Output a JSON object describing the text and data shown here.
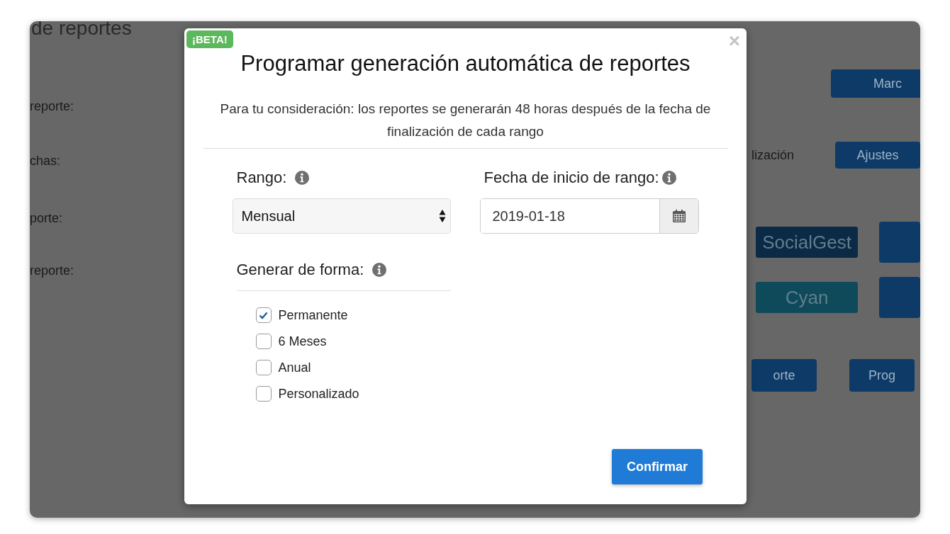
{
  "background": {
    "heading": "de reportes",
    "labels": [
      "reporte:",
      "chas:",
      "porte:",
      "reporte:"
    ],
    "top_button": "Marc",
    "setting_label": "lización",
    "settings_button": "Ajustes",
    "logo_tiles": [
      {
        "label": "SocialGest",
        "color": "#0b2a45"
      },
      {
        "label": "Cyan",
        "color": "#0f4a5a"
      }
    ],
    "bottom_buttons": [
      "orte",
      "Prog"
    ]
  },
  "modal": {
    "badge": "¡BETA!",
    "close": "×",
    "title": "Programar generación automática de reportes",
    "note": "Para tu consideración: los reportes se generarán 48 horas después de la fecha de finalización de cada rango",
    "range": {
      "label": "Rango:",
      "value": "Mensual"
    },
    "start_date": {
      "label": "Fecha de inicio de rango:",
      "value": "2019-01-18"
    },
    "mode": {
      "label": "Generar de forma:",
      "options": [
        {
          "label": "Permanente",
          "checked": true
        },
        {
          "label": "6 Meses",
          "checked": false
        },
        {
          "label": "Anual",
          "checked": false
        },
        {
          "label": "Personalizado",
          "checked": false
        }
      ]
    },
    "confirm": "Confirmar"
  }
}
